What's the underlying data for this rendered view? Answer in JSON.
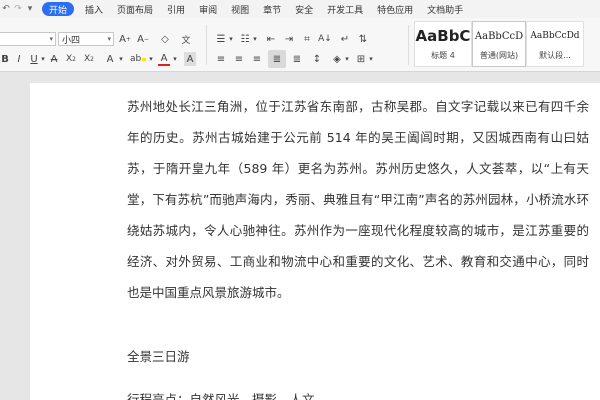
{
  "menu": {
    "tabs": [
      "开始",
      "插入",
      "页面布局",
      "引用",
      "审阅",
      "视图",
      "章节",
      "安全",
      "开发工具",
      "特色应用",
      "文档助手"
    ],
    "active_tab": "开始"
  },
  "ribbon": {
    "font_name": "",
    "font_size": "小四",
    "styles": [
      {
        "sample": "AaBbC",
        "name": "标题 4"
      },
      {
        "sample": "AaBbCcD",
        "name": "普通(网站)"
      },
      {
        "sample": "AaBbCcDd",
        "name": "默认段..."
      }
    ]
  },
  "icons": {
    "undo": "undo-icon",
    "redo": "redo-icon",
    "customize": "customize-icon",
    "grow_font": "grow-font-icon",
    "shrink_font": "shrink-font-icon",
    "clear_format": "clear-format-icon",
    "bold": "bold-icon",
    "italic": "italic-icon",
    "underline": "underline-icon",
    "superscript": "superscript-icon",
    "subscript": "subscript-icon",
    "text_effect": "text-effect-icon",
    "highlight": "highlight-icon",
    "font_color": "font-color-icon",
    "char_shading": "char-shading-icon"
  },
  "colors": {
    "accent": "#2c6ef2",
    "highlight": "#ffe600",
    "font_color": "#e02020"
  },
  "document": {
    "paragraph": "苏州地处长江三角洲，位于江苏省东南部，古称吴郡。自文字记载以来已有四千余年的历史。苏州古城始建于公元前 514 年的吴王阖闾时期，又因城西南有山曰姑苏，于隋开皇九年（589 年）更名为苏州。苏州历史悠久，人文荟萃，以“上有天堂，下有苏杭”而驰声海内，秀丽、典雅且有“甲江南”声名的苏州园林，小桥流水环绕姑苏城内，令人心驰神往。苏州作为一座现代化程度较高的城市，是江苏重要的经济、对外贸易、工商业和物流中心和重要的文化、艺术、教育和交通中心，同时也是中国重点风景旅游城市。",
    "heading": "全景三日游",
    "next_line": "行程亮点：自然风光、摄影、人文"
  }
}
